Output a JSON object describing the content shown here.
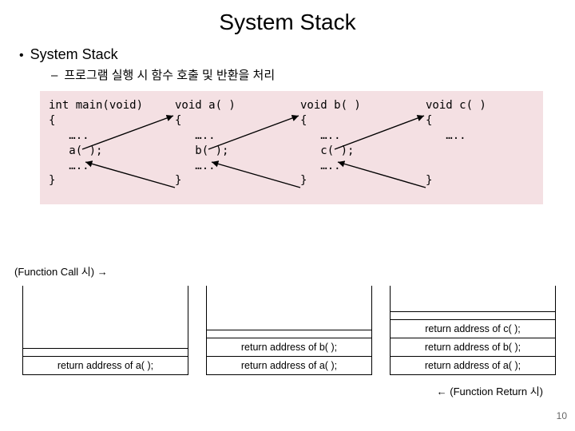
{
  "title": "System Stack",
  "bullet1": "System Stack",
  "bullet2": "프로그램 실행 시 함수 호출 및 반환을 처리",
  "code": {
    "main": {
      "sig": "int main(void)",
      "open": "{",
      "l1": "   …..",
      "l2": "   a( );",
      "l3": "   …..",
      "close": "}"
    },
    "a": {
      "sig": "void a( )",
      "open": "{",
      "l1": "   …..",
      "l2": "   b( );",
      "l3": "   …..",
      "close": "}"
    },
    "b": {
      "sig": "void b( )",
      "open": "{",
      "l1": "   …..",
      "l2": "   c( );",
      "l3": "   …..",
      "close": "}"
    },
    "c": {
      "sig": "void c( )",
      "open": "{",
      "l1": "   …..",
      "close": "}"
    }
  },
  "fc_label": "(Function Call 시) →",
  "stacks": {
    "s1": {
      "f1": "return address of a( );"
    },
    "s2": {
      "f1": "return address of b( );",
      "f2": "return address of a( );"
    },
    "s3": {
      "f1": "return address of c( );",
      "f2": "return address of b( );",
      "f3": "return address of a( );"
    }
  },
  "return_label": "← (Function Return 시)",
  "pagenum": "10"
}
